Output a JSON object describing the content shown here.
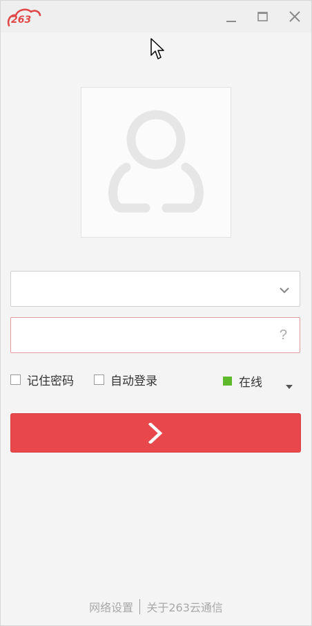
{
  "window": {
    "logo_text": "263",
    "brand_color": "#e04848"
  },
  "form": {
    "username_value": "",
    "password_value": "",
    "dropdown_icon": "chevron-down-icon",
    "help_label": "?"
  },
  "options": {
    "remember_label": "记住密码",
    "auto_login_label": "自动登录",
    "remember_checked": false,
    "auto_login_checked": false
  },
  "status": {
    "label": "在线",
    "color": "#5db82a"
  },
  "login_button": {
    "color": "#e8484c",
    "icon": "chevron-right-icon"
  },
  "footer": {
    "network_settings": "网络设置",
    "about": "关于263云通信"
  }
}
